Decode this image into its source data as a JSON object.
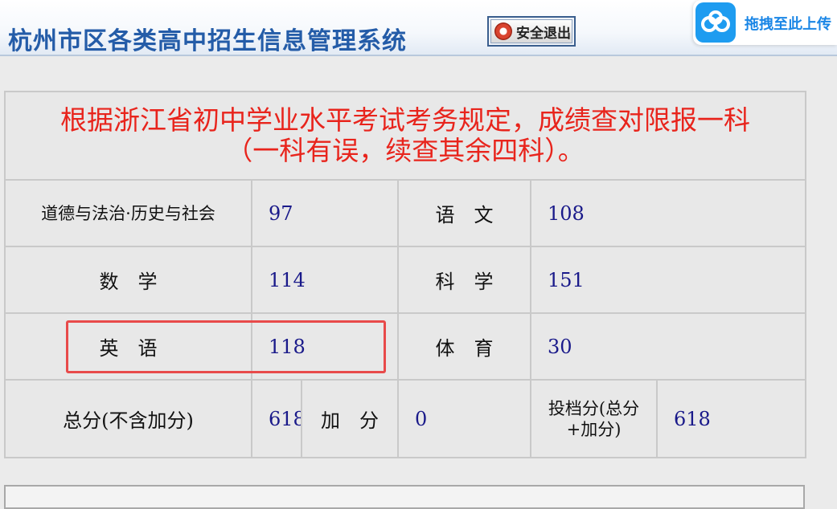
{
  "header": {
    "title": "杭州市区各类高中招生信息管理系统",
    "logout_label": "安全退出",
    "upload_label": "拖拽至此上传"
  },
  "notice": {
    "line1": "根据浙江省初中学业水平考试考务规定，成绩查对限报一科",
    "line2": "（一科有误，续查其余四科）。"
  },
  "scores": {
    "morality_label": "道德与法治·历史与社会",
    "morality_value": "97",
    "chinese_label": "语　文",
    "chinese_value": "108",
    "math_label": "数　学",
    "math_value": "114",
    "science_label": "科　学",
    "science_value": "151",
    "english_label": "英　语",
    "english_value": "118",
    "pe_label": "体　育",
    "pe_value": "30",
    "total_label": "总分(不含加分)",
    "total_value": "618",
    "bonus_label": "加　分",
    "bonus_value": "0",
    "filing_label": "投档分(总分+加分)",
    "filing_value": "618"
  },
  "colors": {
    "title": "#245ca8",
    "notice": "#e8241c",
    "value": "#1a1a8a",
    "highlight": "#e84a4a",
    "upload_accent": "#1e9cf0"
  },
  "icons": {
    "logout": "power-icon",
    "upload": "cloud-icon"
  }
}
